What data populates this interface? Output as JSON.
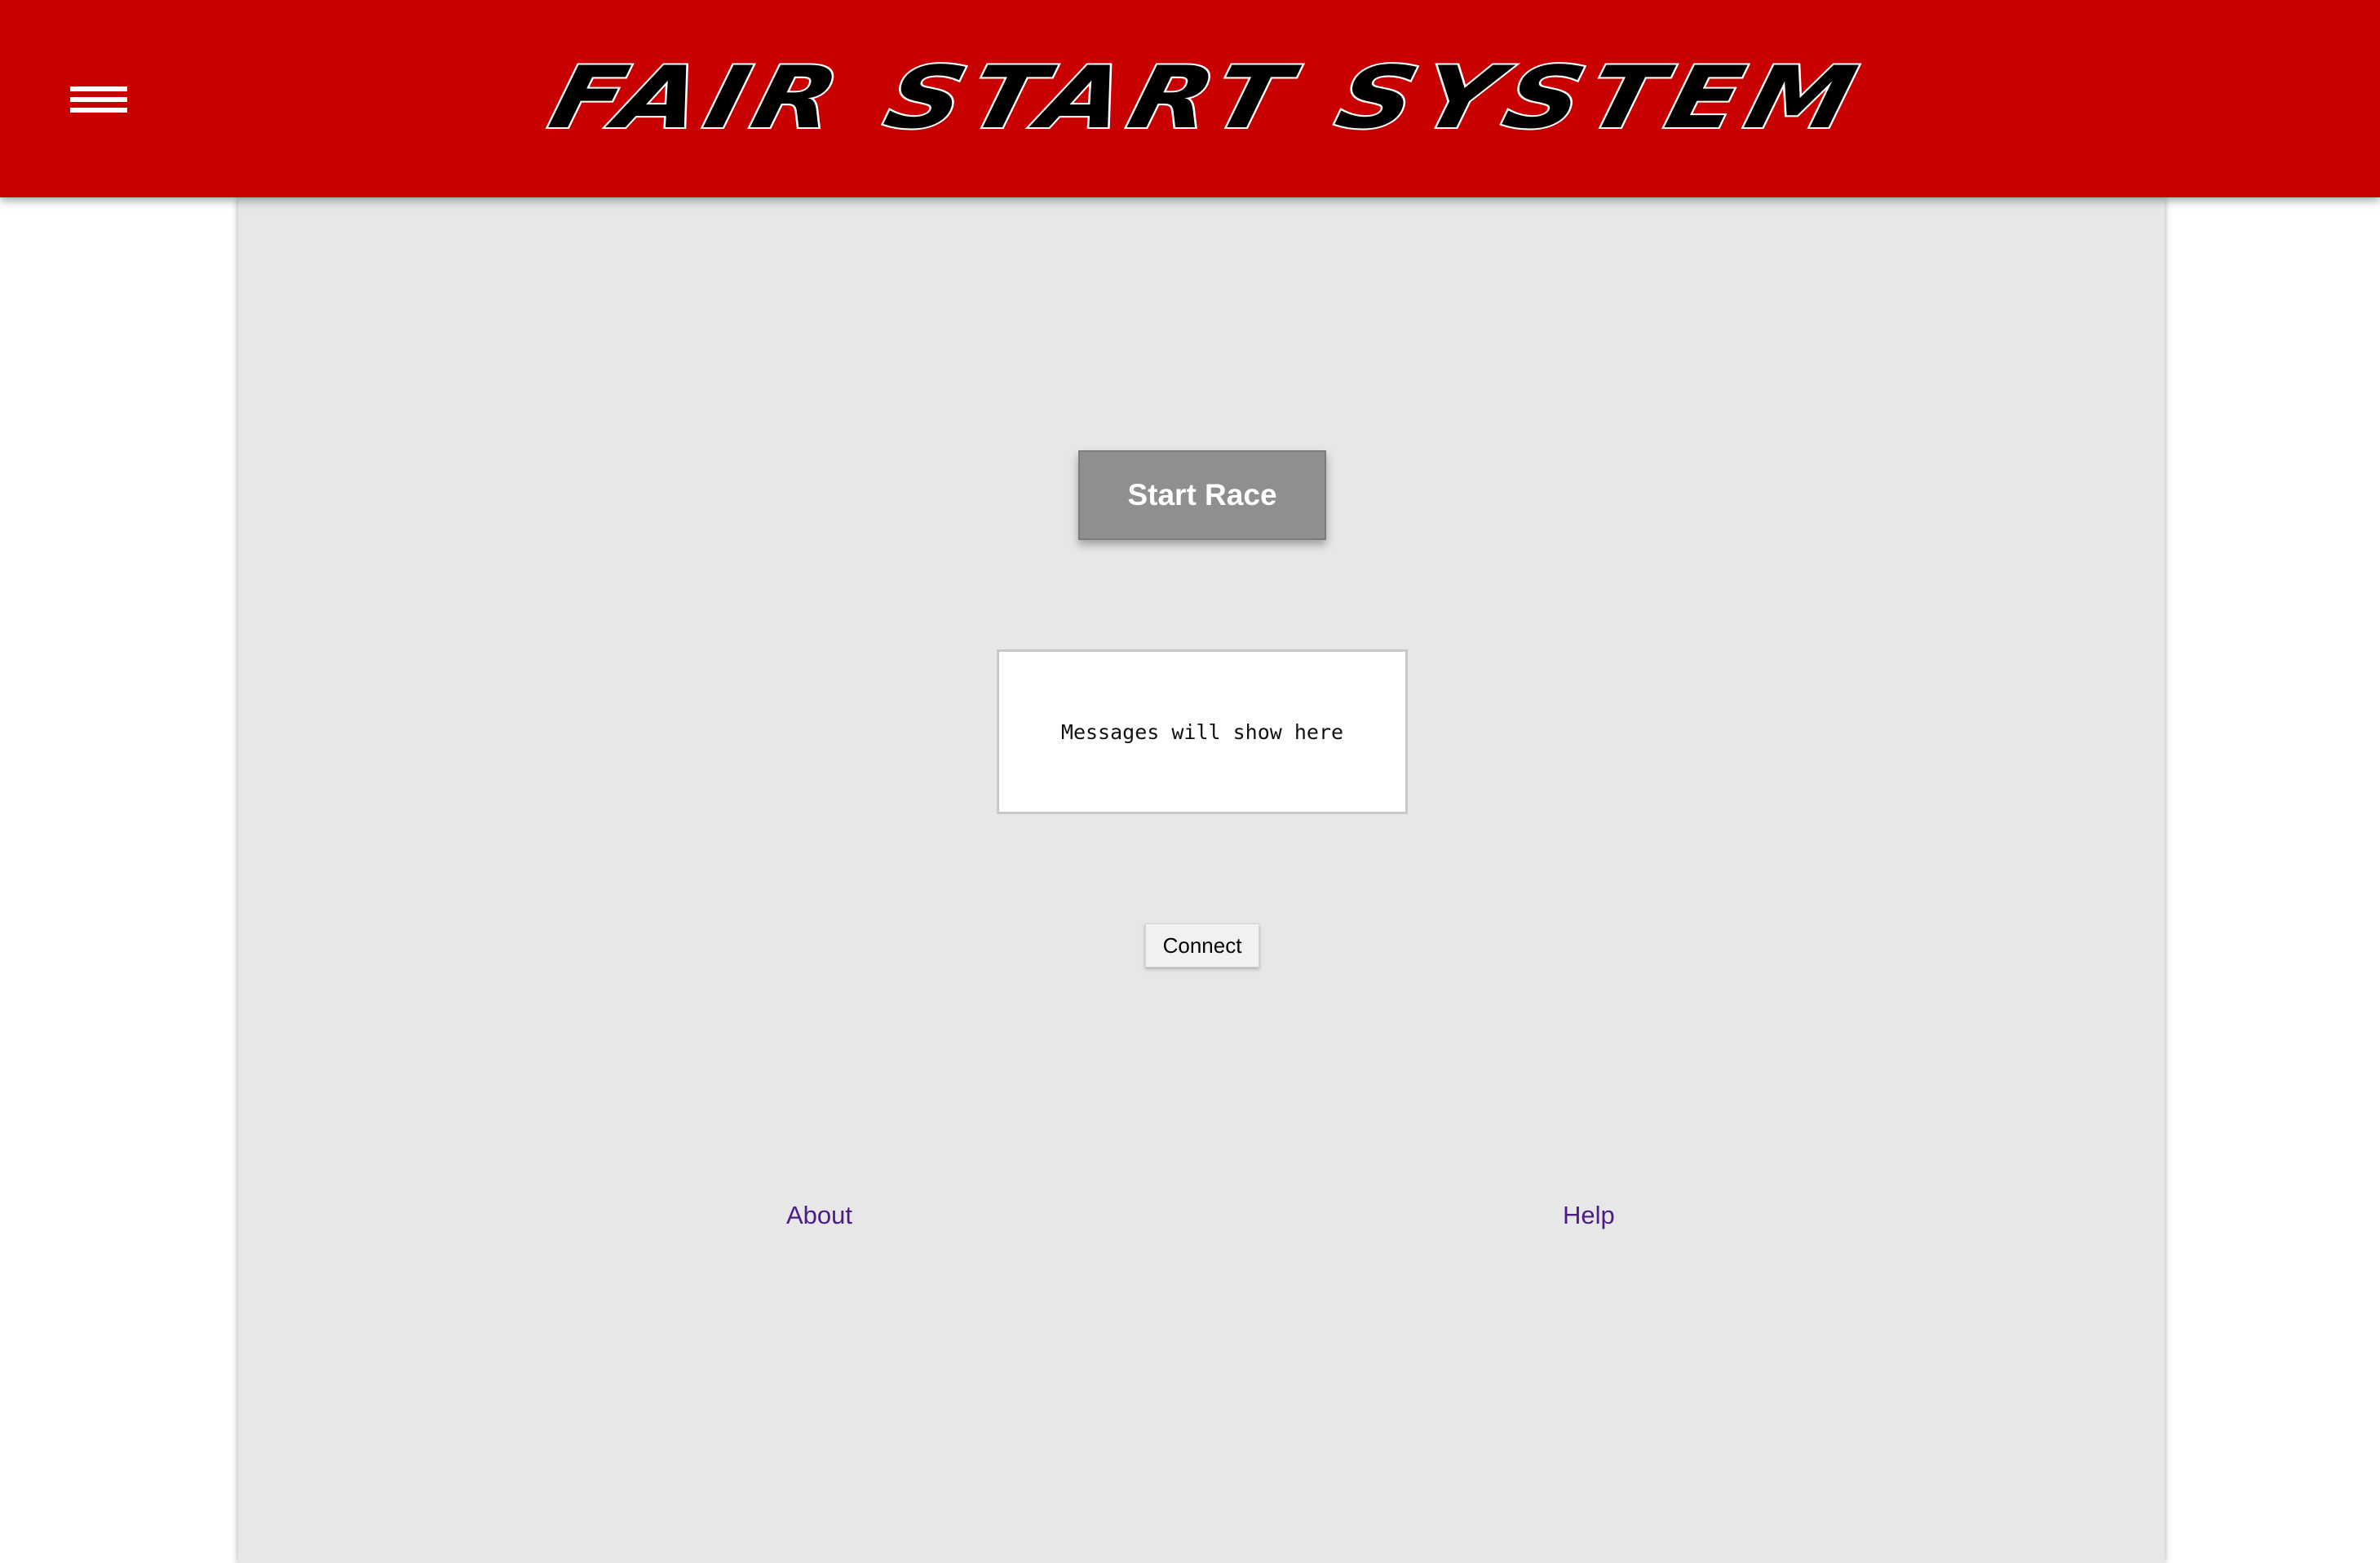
{
  "header": {
    "title": "Fair Start System",
    "background_color": "#c80000",
    "menu_icon": "hamburger-menu-icon"
  },
  "main": {
    "start_button_label": "Start Race",
    "message_placeholder": "Messages will show here",
    "connect_button_label": "Connect"
  },
  "footer": {
    "about_label": "About",
    "help_label": "Help",
    "link_color": "#4b1b86"
  }
}
